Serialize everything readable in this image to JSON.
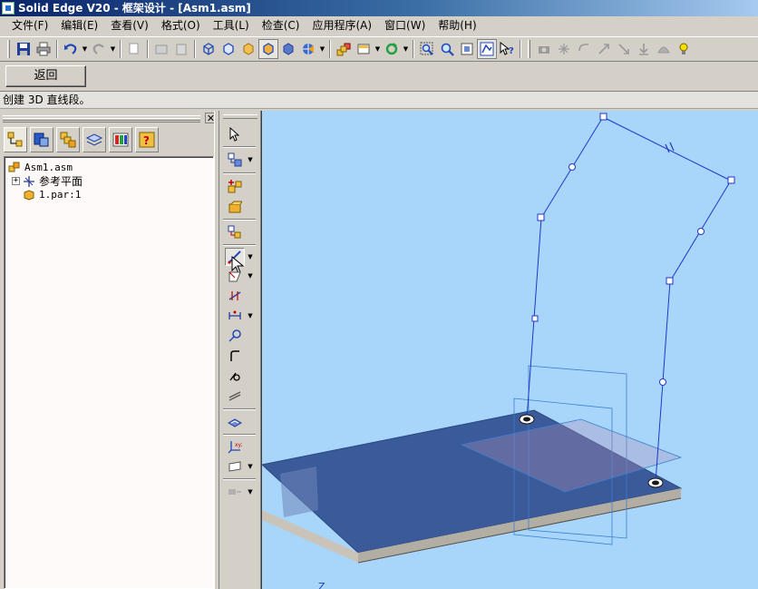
{
  "window": {
    "title": "Solid Edge V20 - 框架设计 - [Asm1.asm]"
  },
  "menu": [
    "文件(F)",
    "编辑(E)",
    "查看(V)",
    "格式(O)",
    "工具(L)",
    "检查(C)",
    "应用程序(A)",
    "窗口(W)",
    "帮助(H)"
  ],
  "command_bar": {
    "back_label": "返回"
  },
  "prompt": {
    "text": "创建 3D 直线段。"
  },
  "edgebar": {
    "close_label": "✕",
    "tabs": [
      "assembly-pathfinder",
      "parts-library",
      "feature-library",
      "layers",
      "display-configurations",
      "sensors"
    ],
    "tree": [
      {
        "label": "Asm1.asm",
        "icon": "assembly-icon"
      },
      {
        "label": "参考平面",
        "icon": "reference-plane-icon",
        "expander": "+"
      },
      {
        "label": "1.par:1",
        "icon": "part-icon"
      }
    ]
  },
  "viewport": {
    "axis_label": "Z"
  },
  "colors": {
    "viewport_bg": "#a8d6fb",
    "sketch_line": "#2136c8",
    "plate": "#3a5a99"
  }
}
